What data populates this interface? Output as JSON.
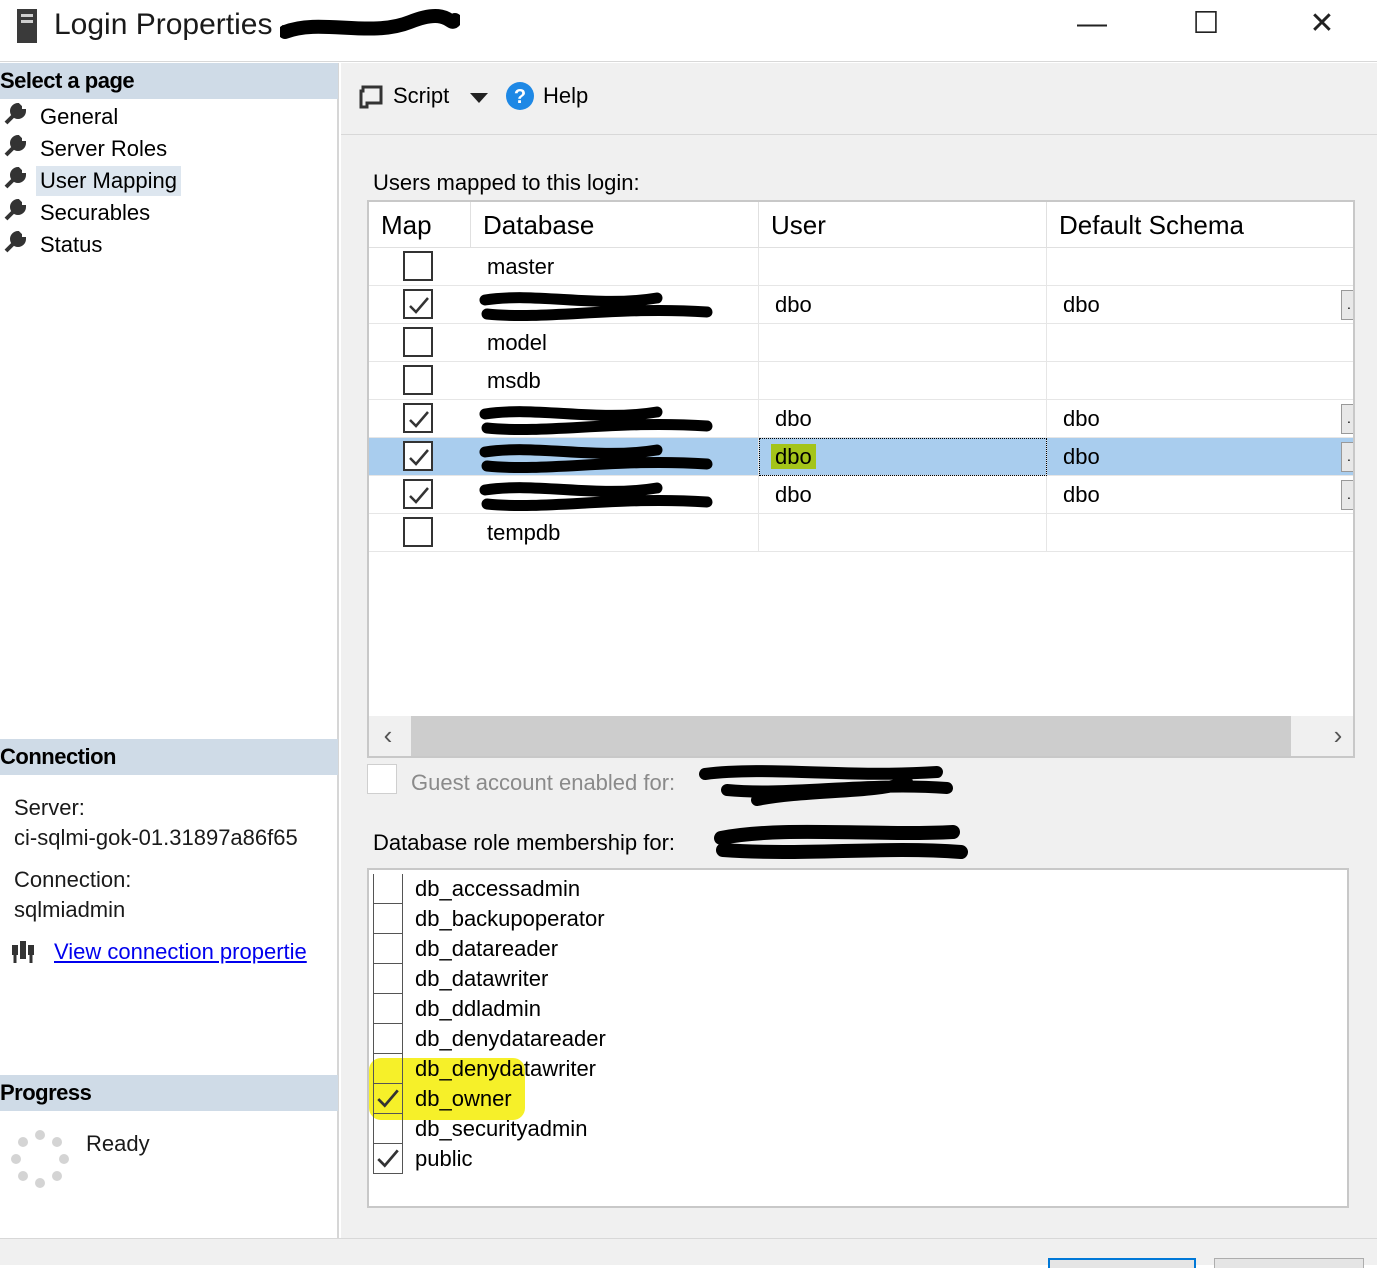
{
  "window": {
    "title": "Login Properties -",
    "minimize": "—",
    "maximize": "☐",
    "close": "✕"
  },
  "left": {
    "select_page_header": "Select a page",
    "pages": [
      {
        "label": "General"
      },
      {
        "label": "Server Roles"
      },
      {
        "label": "User Mapping",
        "selected": true
      },
      {
        "label": "Securables"
      },
      {
        "label": "Status"
      }
    ],
    "connection_header": "Connection",
    "server_label": "Server:",
    "server_value": "ci-sqlmi-gok-01.31897a86f65",
    "connection_label": "Connection:",
    "connection_value": "sqlmiadmin",
    "view_link": "View connection propertie",
    "progress_header": "Progress",
    "progress_status": "Ready"
  },
  "toolbar": {
    "script_label": "Script",
    "help_label": "Help"
  },
  "users_mapped": {
    "label": "Users mapped to this login:",
    "columns": [
      "Map",
      "Database",
      "User",
      "Default Schema"
    ],
    "rows": [
      {
        "checked": false,
        "database": "master",
        "user": "",
        "schema": "",
        "redacted": false
      },
      {
        "checked": true,
        "database": "",
        "user": "dbo",
        "schema": "dbo",
        "redacted": true
      },
      {
        "checked": false,
        "database": "model",
        "user": "",
        "schema": "",
        "redacted": false
      },
      {
        "checked": false,
        "database": "msdb",
        "user": "",
        "schema": "",
        "redacted": false
      },
      {
        "checked": true,
        "database": "",
        "user": "dbo",
        "schema": "dbo",
        "redacted": true
      },
      {
        "checked": true,
        "database": "",
        "user": "dbo",
        "schema": "dbo",
        "redacted": true,
        "selected": true
      },
      {
        "checked": true,
        "database": "",
        "user": "dbo",
        "schema": "dbo",
        "redacted": true
      },
      {
        "checked": false,
        "database": "tempdb",
        "user": "",
        "schema": "",
        "redacted": false
      }
    ]
  },
  "guest_label": "Guest account enabled for:",
  "role_membership": {
    "label": "Database role membership for:",
    "roles": [
      {
        "label": "db_accessadmin",
        "checked": false
      },
      {
        "label": "db_backupoperator",
        "checked": false
      },
      {
        "label": "db_datareader",
        "checked": false
      },
      {
        "label": "db_datawriter",
        "checked": false
      },
      {
        "label": "db_ddladmin",
        "checked": false
      },
      {
        "label": "db_denydatareader",
        "checked": false
      },
      {
        "label": "db_denydatawriter",
        "checked": false
      },
      {
        "label": "db_owner",
        "checked": true
      },
      {
        "label": "db_securityadmin",
        "checked": false
      },
      {
        "label": "public",
        "checked": true
      }
    ]
  },
  "colors": {
    "section_header": "#cfdbe7",
    "selected_row": "#a9cdee",
    "highlight_yellow": "#f5ef1d",
    "highlight_green": "#a4c41a",
    "link": "#0000ee"
  }
}
